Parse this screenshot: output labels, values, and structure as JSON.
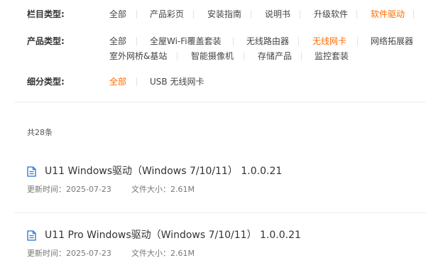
{
  "filters": {
    "column": {
      "label": "栏目类型:",
      "options": [
        "全部",
        "产品彩页",
        "安装指南",
        "说明书",
        "升级软件",
        "软件驱动"
      ]
    },
    "product": {
      "label": "产品类型:",
      "options": [
        "全部",
        "全屋Wi-Fi覆盖套装",
        "无线路由器",
        "无线网卡",
        "网络拓展器",
        "室外网桥&基站",
        "智能摄像机",
        "存储产品",
        "监控套装"
      ]
    },
    "sub": {
      "label": "细分类型:",
      "options": [
        "全部",
        "USB 无线网卡"
      ]
    }
  },
  "result_count": "共28条",
  "drivers": [
    {
      "title": "U11 Windows驱动（Windows 7/10/11） 1.0.0.21",
      "updated": "更新时间：2025-07-23",
      "size": "文件大小：2.61M"
    },
    {
      "title": "U11 Pro Windows驱动（Windows 7/10/11） 1.0.0.21",
      "updated": "更新时间：2025-07-23",
      "size": "文件大小：2.61M"
    }
  ],
  "colors": {
    "accent": "#ff6a00",
    "icon": "#1a73d9"
  }
}
